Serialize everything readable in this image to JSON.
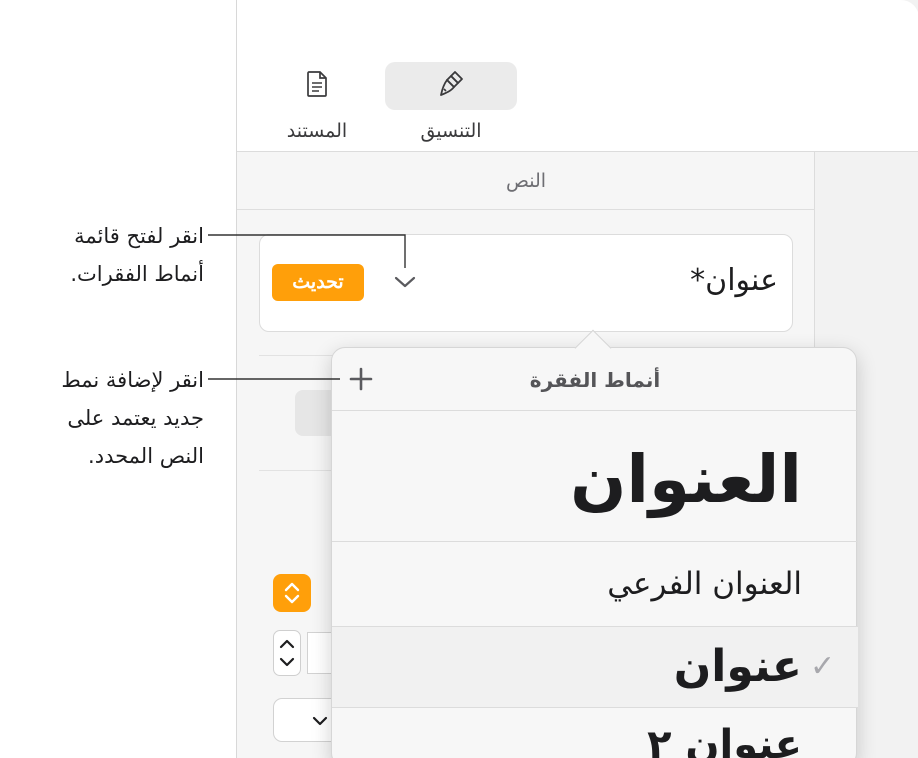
{
  "tabs": [
    {
      "label": "التنسيق",
      "icon": "paintbrush-icon",
      "selected": true
    },
    {
      "label": "المستند",
      "icon": "document-icon",
      "selected": false
    }
  ],
  "inspector": {
    "section_title": "النص",
    "paragraph_style_name": "عنوان*",
    "update_label": "تحديث"
  },
  "popover": {
    "title": "أنماط الفقرة",
    "add_icon": "plus-icon",
    "styles": [
      {
        "label": "العنوان",
        "selected": false
      },
      {
        "label": "العنوان الفرعي",
        "selected": false
      },
      {
        "label": "عنوان",
        "selected": true
      },
      {
        "label": "عنوان ٢",
        "selected": false
      }
    ]
  },
  "callouts": {
    "open_menu": [
      "انقر لفتح قائمة",
      "أنماط الفقرات."
    ],
    "add_style": [
      "انقر لإضافة نمط",
      "جديد يعتمد على",
      "النص المحدد."
    ]
  },
  "colors": {
    "accent": "#ff9f0a",
    "panel_bg": "#f2f2f2",
    "popover_bg": "#f7f7f7"
  }
}
